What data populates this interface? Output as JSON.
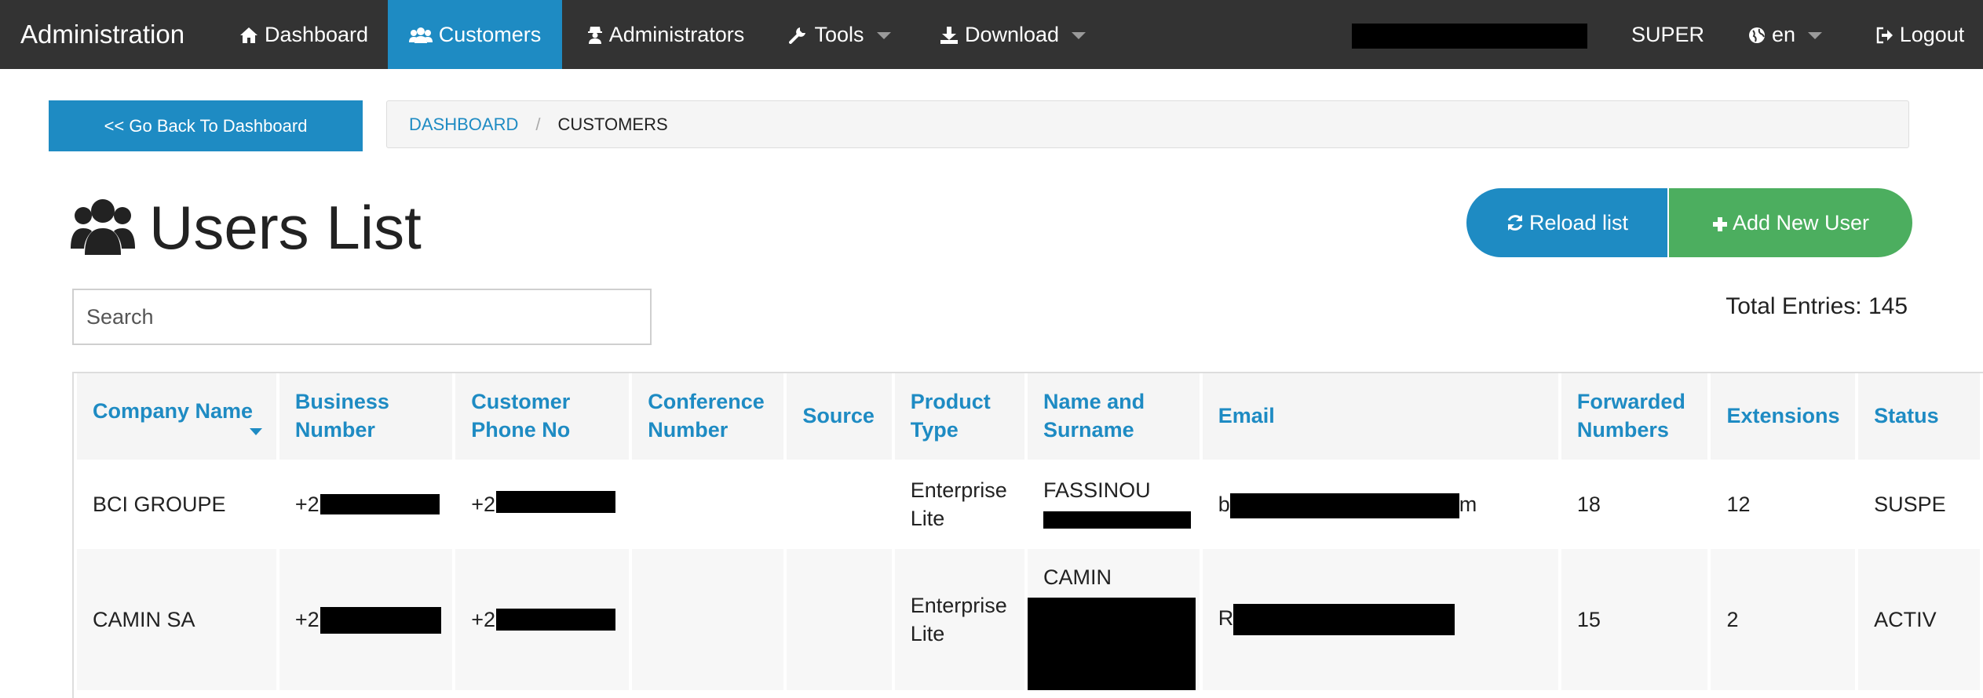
{
  "navbar": {
    "brand": "Administration",
    "items": [
      {
        "label": "Dashboard",
        "icon": "home-icon",
        "active": false
      },
      {
        "label": "Customers",
        "icon": "users-icon",
        "active": true
      },
      {
        "label": "Administrators",
        "icon": "user-secret-icon",
        "active": false
      },
      {
        "label": "Tools",
        "icon": "wrench-icon",
        "active": false,
        "dropdown": true
      },
      {
        "label": "Download",
        "icon": "download-icon",
        "active": false,
        "dropdown": true
      }
    ],
    "user_role": "SUPER",
    "language": "en",
    "logout": "Logout",
    "active_color": "#1e8bc3",
    "bar_color": "#333333"
  },
  "back_button": "<< Go Back To Dashboard",
  "breadcrumb": {
    "home": "DASHBOARD",
    "current": "CUSTOMERS"
  },
  "page": {
    "title": "Users List",
    "title_icon": "users-icon"
  },
  "actions": {
    "reload": "Reload list",
    "add": "Add New User",
    "reload_color": "#1e8bc3",
    "add_color": "#4cae5f"
  },
  "search": {
    "placeholder": "Search",
    "value": ""
  },
  "total_entries": "Total Entries: 145",
  "table": {
    "headers": {
      "company": "Company Name",
      "business": "Business Number",
      "phone": "Customer Phone No",
      "conference": "Conference Number",
      "source": "Source",
      "product": "Product Type",
      "name": "Name and Surname",
      "email": "Email",
      "forwarded": "Forwarded Numbers",
      "extensions": "Extensions",
      "status": "Status"
    },
    "rows": [
      {
        "company": "BCI GROUPE",
        "business": "+22",
        "phone": "+22",
        "conference": "",
        "source": "",
        "product": "Enterprise Lite",
        "name": "FASSINOU",
        "email_start": "b",
        "email_end": "m",
        "forwarded": "18",
        "extensions": "12",
        "status": "SUSPE"
      },
      {
        "company": "CAMIN SA",
        "business": "+22",
        "phone": "+22",
        "conference": "",
        "source": "",
        "product": "Enterprise Lite",
        "name": "CAMIN",
        "email_start": "R",
        "email_end": "",
        "forwarded": "15",
        "extensions": "2",
        "status": "ACTIV"
      }
    ]
  }
}
